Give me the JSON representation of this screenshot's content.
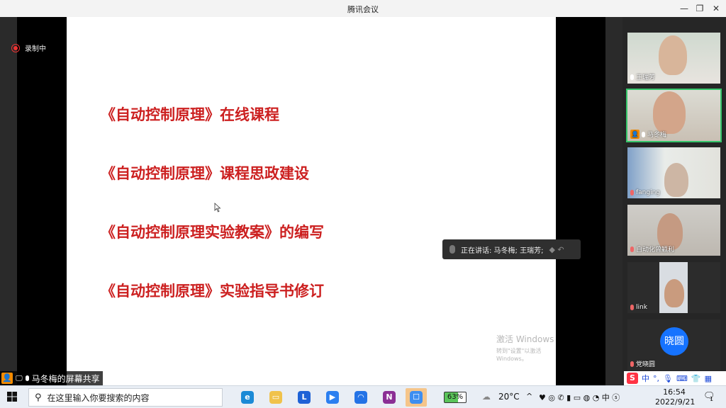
{
  "window": {
    "title": "腾讯会议",
    "controls": [
      "minimize-icon",
      "restore-icon",
      "close-icon"
    ]
  },
  "recording": {
    "label": "录制中"
  },
  "slide": {
    "lines": [
      "《自动控制原理》在线课程",
      "《自动控制原理》课程思政建设",
      "《自动控制原理实验教案》的编写",
      "《自动控制原理》实验指导书修订"
    ],
    "text_color": "#cc2020"
  },
  "speaking_banner": {
    "text": "正在讲话: 马冬梅; 王瑞芳;"
  },
  "watermark": {
    "line1": "激活 Windows",
    "line2": "转到\"设置\"以激活 Windows。"
  },
  "share_label": {
    "text": "马冬梅的屏幕共享"
  },
  "participants": [
    {
      "name": "王瑞芳",
      "mic": "on"
    },
    {
      "name": "马冬梅",
      "mic": "on",
      "active": true
    },
    {
      "name": "fanging",
      "mic": "off"
    },
    {
      "name": "自动化曾颖利",
      "mic": "off"
    },
    {
      "name": "link",
      "mic": "off"
    },
    {
      "name": "党晓圆",
      "mic": "off",
      "avatar_text": "晓圆"
    }
  ],
  "ime": {
    "mode": "中"
  },
  "taskbar": {
    "search_placeholder": "在这里输入你要搜索的内容",
    "battery": "63%",
    "temperature": "20°C",
    "time": "16:54",
    "date": "2022/9/21",
    "notification_count": "1"
  },
  "colors": {
    "accent": "#1673ff",
    "speaking_border": "#35c56a",
    "share_orange": "#f38b00"
  }
}
